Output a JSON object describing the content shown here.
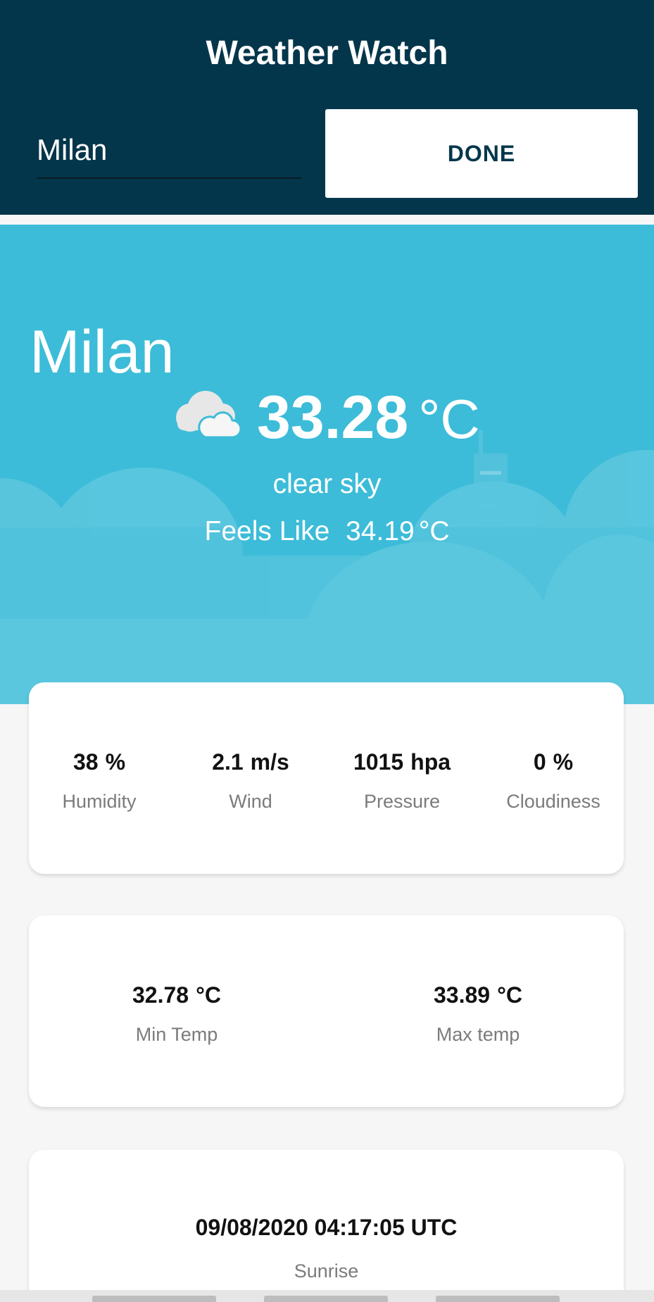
{
  "header": {
    "title": "Weather Watch",
    "city_input_value": "Milan",
    "done_label": "DONE"
  },
  "hero": {
    "city": "Milan",
    "temperature": "33.28",
    "unit": "°C",
    "description": "clear sky",
    "feels_like_label": "Feels Like",
    "feels_like_value": "34.19",
    "feels_like_unit": "°C",
    "icon": "cloud-icon"
  },
  "stats": [
    {
      "value": "38",
      "unit": "%",
      "label": "Humidity"
    },
    {
      "value": "2.1",
      "unit": "m/s",
      "label": "Wind"
    },
    {
      "value": "1015",
      "unit": "hpa",
      "label": "Pressure"
    },
    {
      "value": "0",
      "unit": "%",
      "label": "Cloudiness"
    }
  ],
  "temps": [
    {
      "value": "32.78",
      "unit": "°C",
      "label": "Min Temp"
    },
    {
      "value": "33.89",
      "unit": "°C",
      "label": "Max temp"
    }
  ],
  "sun": {
    "sunrise_value": "09/08/2020 04:17:05 UTC",
    "sunrise_label": "Sunrise"
  },
  "colors": {
    "header_bg": "#04364b",
    "hero_bg": "#3cbcd8",
    "card_bg": "#ffffff"
  }
}
